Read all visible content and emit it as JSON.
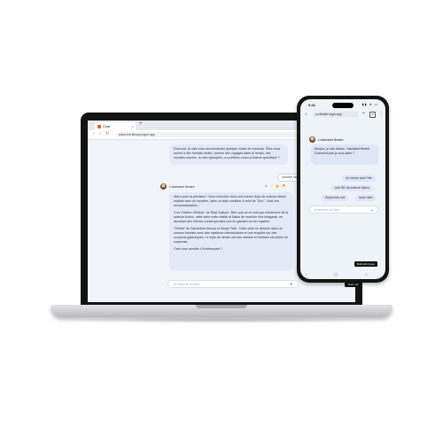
{
  "laptop": {
    "tab_title": "Chat",
    "tab_close": "×",
    "new_tab": "+",
    "window_controls": "– ▢ ×",
    "nav_icons": "‹ › ↻",
    "url": "www.bot-library.ingen.app",
    "menu_icon": "⋮",
    "messages": {
      "bot_intro": "D'accord, je vais vous recommander quelque chose de nouveau. Êtes-vous ouvert à des formats variés, comme des voyages dans le temps, des mondes-univers, ou des dystopies, ou préférez-vous un thème spécifique ?",
      "user_reply": "comme ha",
      "author_name": "L'assistant libraire",
      "actions": "⧉ ↺ 👍 👎",
      "intro_line": "Merci pour la précision ! Vous cherchez donc une bonne dose de science-fiction réaliste avec un mystère, dans un style similaire à celui de \"Sun\". Voici une recommandation :",
      "book1": "\"Les Cahiers d'Esther\" de Riad Sattouf : Bien que ce ne soit pas strictement de la science-fiction, cette série mêle réalité et fiction de manière très intrigante, en abordant des thèmes contemporains tout en gardant un fort mystère.",
      "book2": "\"Orbital\" de Samantha Harvey et Serge Petit : Cette série se déroule dans un univers futuriste avec des mystères interstellaires et une enquête sur des complots galactiques. Le style de dessin est très réaliste et l'histoire est pleine de suspense.",
      "closing": "Cela vous semble-t-il intéressant ?"
    },
    "input_placeholder": "Je cherche un livre...",
    "send_icon": "➤",
    "built_with": "Built with"
  },
  "phone": {
    "time": "9:41",
    "status_icons": "▮▮ ≋ ▭",
    "home_icon": "⌂",
    "url": "ou-librairie.ingen.app",
    "plus_icon": "+",
    "tabs_count": "1",
    "menu_icon": "⋮",
    "author_name": "L'assistant libraire",
    "greeting": "Bonjour, je suis Manon, l'assistant libraire. Comment puis-je vous aider ?",
    "suggestions": [
      "Un roman pour l'été",
      "Une BD de science fiction",
      "Surprends-moi",
      "Autre idée"
    ],
    "input_placeholder": "Je cherche un livre...",
    "send_icon": "➤",
    "built_with": "Built with Ingen",
    "nav_icons": "‹ ▢ ⌂"
  }
}
